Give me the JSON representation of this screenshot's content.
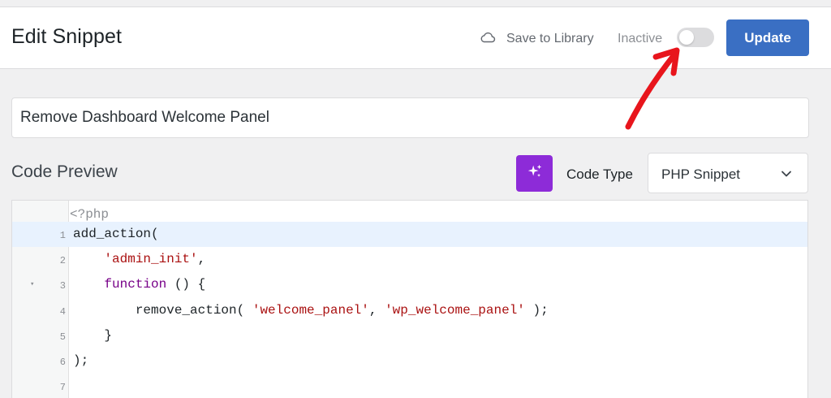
{
  "header": {
    "title": "Edit Snippet",
    "save_to_library": "Save to Library",
    "status_label": "Inactive",
    "update_label": "Update",
    "accent_color": "#3a6fc3"
  },
  "snippet": {
    "title_value": "Remove Dashboard Welcome Panel"
  },
  "code_preview": {
    "section_title": "Code Preview",
    "code_type_label": "Code Type",
    "code_type_value": "PHP Snippet",
    "ai_button_icon": "sparkles-icon",
    "ai_button_color": "#8d2bd8"
  },
  "editor": {
    "meta_line": "<?php",
    "lines": [
      {
        "no": "1",
        "parts": [
          {
            "t": "add_action(",
            "c": ""
          }
        ]
      },
      {
        "no": "2",
        "parts": [
          {
            "t": "    ",
            "c": ""
          },
          {
            "t": "'admin_init'",
            "c": "str"
          },
          {
            "t": ",",
            "c": ""
          }
        ]
      },
      {
        "no": "3",
        "parts": [
          {
            "t": "    ",
            "c": ""
          },
          {
            "t": "function",
            "c": "kw"
          },
          {
            "t": " () {",
            "c": ""
          }
        ]
      },
      {
        "no": "4",
        "parts": [
          {
            "t": "        remove_action( ",
            "c": ""
          },
          {
            "t": "'welcome_panel'",
            "c": "str"
          },
          {
            "t": ", ",
            "c": ""
          },
          {
            "t": "'wp_welcome_panel'",
            "c": "str"
          },
          {
            "t": " );",
            "c": ""
          }
        ]
      },
      {
        "no": "5",
        "parts": [
          {
            "t": "    }",
            "c": ""
          }
        ]
      },
      {
        "no": "6",
        "parts": [
          {
            "t": ");",
            "c": ""
          }
        ]
      },
      {
        "no": "7",
        "parts": [
          {
            "t": "",
            "c": ""
          }
        ]
      }
    ],
    "active_line": "1",
    "fold_line": "3"
  },
  "annotation": {
    "arrow_color": "#e8151c"
  }
}
